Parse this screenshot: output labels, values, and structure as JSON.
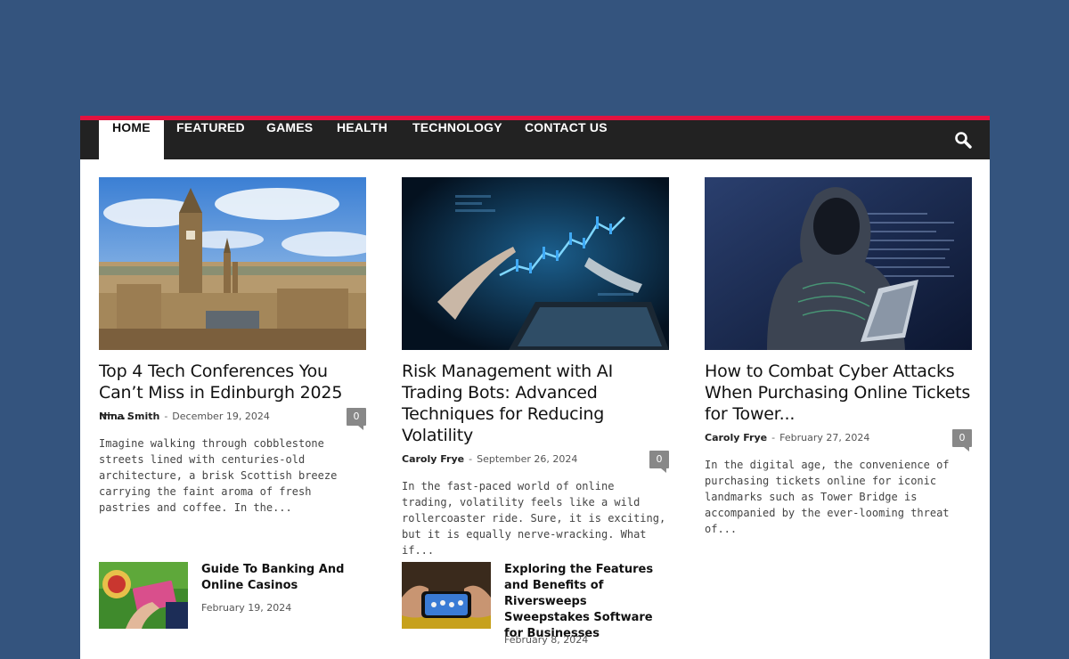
{
  "nav": {
    "tabs": [
      "HOME",
      "FEATURED",
      "GAMES",
      "HEALTH",
      "TECHNOLOGY",
      "CONTACT US"
    ],
    "active": "HOME",
    "search_icon": "search-icon"
  },
  "posts": [
    {
      "title": "Top 4 Tech Conferences You Can’t Miss in Edinburgh 2025 —...",
      "author": "Nina Smith",
      "date": "December 19, 2024",
      "comments": "0",
      "excerpt": "Imagine walking through cobblestone streets lined with centuries-old architecture, a brisk Scottish breeze carrying the faint aroma of fresh pastries and coffee. In the..."
    },
    {
      "title": "Risk Management with AI Trading Bots: Advanced Techniques for Reducing Volatility",
      "author": "Caroly Frye",
      "date": "September 26, 2024",
      "comments": "0",
      "excerpt": "In the fast-paced world of online trading, volatility feels like a wild rollercoaster ride. Sure, it is exciting, but it is equally nerve-wracking. What if..."
    },
    {
      "title": "How to Combat Cyber Attacks When Purchasing Online Tickets for Tower...",
      "author": "Caroly Frye",
      "date": "February 27, 2024",
      "comments": "0",
      "excerpt": "In the digital age, the convenience of purchasing tickets online for iconic landmarks such as Tower Bridge is accompanied by the ever-looming threat of..."
    }
  ],
  "small_posts": [
    {
      "title": "Guide To Banking And Online Casinos",
      "date": "February 19, 2024"
    },
    {
      "title": "Exploring the Features and Benefits of Riversweeps Sweepstakes Software for Businesses",
      "date": "February 8, 2024"
    }
  ]
}
